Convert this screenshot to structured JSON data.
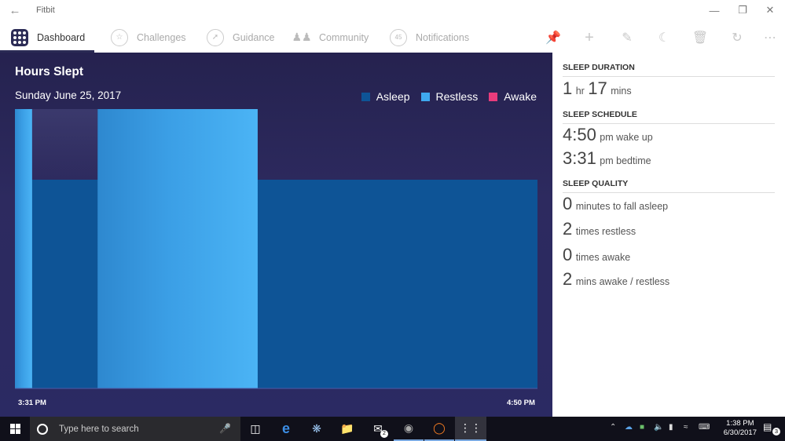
{
  "window": {
    "title": "Fitbit"
  },
  "nav": {
    "items": [
      {
        "label": "Dashboard",
        "icon": "dashboard-icon"
      },
      {
        "label": "Challenges",
        "icon": "challenges-icon"
      },
      {
        "label": "Guidance",
        "icon": "guidance-icon"
      },
      {
        "label": "Community",
        "icon": "community-icon"
      },
      {
        "label": "Notifications",
        "icon": "notifications-icon",
        "badge": "45"
      }
    ]
  },
  "chart_data": {
    "type": "bar",
    "title": "Hours Slept",
    "subtitle": "Sunday June 25, 2017",
    "legend": [
      {
        "name": "Asleep",
        "color": "#0e5496"
      },
      {
        "name": "Restless",
        "color": "#3fa9ef"
      },
      {
        "name": "Awake",
        "color": "#e83c7c"
      }
    ],
    "x_labels": [
      "3:31 PM",
      "4:50 PM"
    ],
    "x_start": "3:31 PM",
    "x_end": "4:50 PM",
    "segments": [
      {
        "state": "Restless",
        "start_min": 0,
        "end_min": 2.6
      },
      {
        "state": "Asleep",
        "start_min": 2.6,
        "end_min": 12.5
      },
      {
        "state": "Restless",
        "start_min": 12.5,
        "end_min": 36.7
      },
      {
        "state": "Asleep",
        "start_min": 36.7,
        "end_min": 79
      }
    ]
  },
  "stats": {
    "duration_head": "SLEEP DURATION",
    "duration_hr": "1",
    "duration_hr_unit": "hr",
    "duration_min": "17",
    "duration_min_unit": "mins",
    "schedule_head": "SLEEP SCHEDULE",
    "wake_time": "4:50",
    "wake_suffix": "pm wake up",
    "bed_time": "3:31",
    "bed_suffix": "pm bedtime",
    "quality_head": "SLEEP QUALITY",
    "q1_value": "0",
    "q1_label": "minutes to fall asleep",
    "q2_value": "2",
    "q2_label": "times restless",
    "q3_value": "0",
    "q3_label": "times awake",
    "q4_value": "2",
    "q4_label": "mins awake / restless"
  },
  "taskbar": {
    "search_placeholder": "Type here to search",
    "mail_badge": "2",
    "clock_time": "1:38 PM",
    "clock_date": "6/30/2017",
    "notification_count": "3"
  }
}
